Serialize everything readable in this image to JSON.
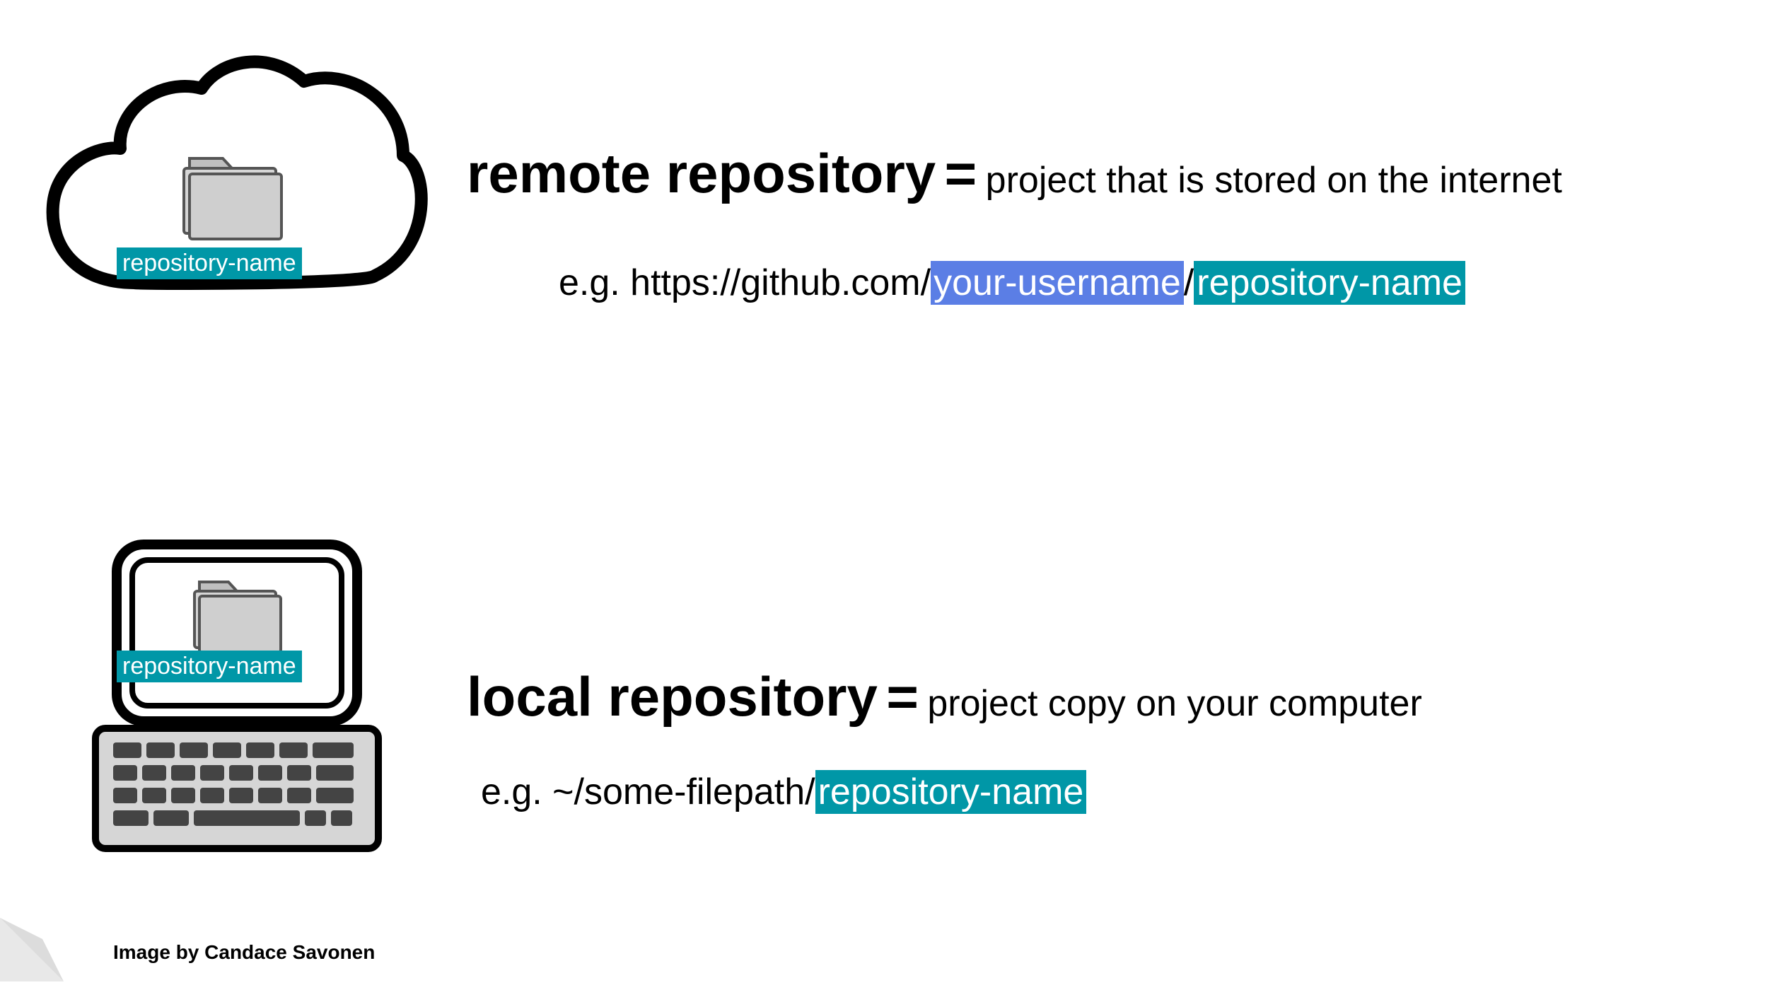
{
  "remote": {
    "term": "remote repository",
    "equals": "=",
    "definition": "project that is stored on the internet",
    "example_prefix": "e.g. https://github.com/",
    "username_placeholder": "your-username",
    "separator": "/",
    "repo_placeholder": "repository-name",
    "icon_label": "repository-name"
  },
  "local": {
    "term": "local repository",
    "equals": "=",
    "definition": "project copy on your computer",
    "example_prefix": "e.g. ~/some-filepath/",
    "repo_placeholder": "repository-name",
    "icon_label": "repository-name"
  },
  "attribution": "Image by Candace Savonen",
  "colors": {
    "teal": "#0097a7",
    "blue": "#5b7ee5"
  }
}
